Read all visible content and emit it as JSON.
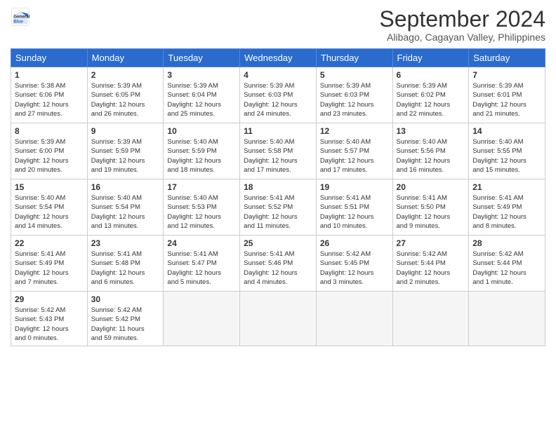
{
  "logo": {
    "line1": "General",
    "line2": "Blue"
  },
  "title": "September 2024",
  "location": "Alibago, Cagayan Valley, Philippines",
  "headers": [
    "Sunday",
    "Monday",
    "Tuesday",
    "Wednesday",
    "Thursday",
    "Friday",
    "Saturday"
  ],
  "weeks": [
    [
      {
        "day": "1",
        "info": "Sunrise: 5:38 AM\nSunset: 6:06 PM\nDaylight: 12 hours\nand 27 minutes."
      },
      {
        "day": "2",
        "info": "Sunrise: 5:39 AM\nSunset: 6:05 PM\nDaylight: 12 hours\nand 26 minutes."
      },
      {
        "day": "3",
        "info": "Sunrise: 5:39 AM\nSunset: 6:04 PM\nDaylight: 12 hours\nand 25 minutes."
      },
      {
        "day": "4",
        "info": "Sunrise: 5:39 AM\nSunset: 6:03 PM\nDaylight: 12 hours\nand 24 minutes."
      },
      {
        "day": "5",
        "info": "Sunrise: 5:39 AM\nSunset: 6:03 PM\nDaylight: 12 hours\nand 23 minutes."
      },
      {
        "day": "6",
        "info": "Sunrise: 5:39 AM\nSunset: 6:02 PM\nDaylight: 12 hours\nand 22 minutes."
      },
      {
        "day": "7",
        "info": "Sunrise: 5:39 AM\nSunset: 6:01 PM\nDaylight: 12 hours\nand 21 minutes."
      }
    ],
    [
      {
        "day": "8",
        "info": "Sunrise: 5:39 AM\nSunset: 6:00 PM\nDaylight: 12 hours\nand 20 minutes."
      },
      {
        "day": "9",
        "info": "Sunrise: 5:39 AM\nSunset: 5:59 PM\nDaylight: 12 hours\nand 19 minutes."
      },
      {
        "day": "10",
        "info": "Sunrise: 5:40 AM\nSunset: 5:59 PM\nDaylight: 12 hours\nand 18 minutes."
      },
      {
        "day": "11",
        "info": "Sunrise: 5:40 AM\nSunset: 5:58 PM\nDaylight: 12 hours\nand 17 minutes."
      },
      {
        "day": "12",
        "info": "Sunrise: 5:40 AM\nSunset: 5:57 PM\nDaylight: 12 hours\nand 17 minutes."
      },
      {
        "day": "13",
        "info": "Sunrise: 5:40 AM\nSunset: 5:56 PM\nDaylight: 12 hours\nand 16 minutes."
      },
      {
        "day": "14",
        "info": "Sunrise: 5:40 AM\nSunset: 5:55 PM\nDaylight: 12 hours\nand 15 minutes."
      }
    ],
    [
      {
        "day": "15",
        "info": "Sunrise: 5:40 AM\nSunset: 5:54 PM\nDaylight: 12 hours\nand 14 minutes."
      },
      {
        "day": "16",
        "info": "Sunrise: 5:40 AM\nSunset: 5:54 PM\nDaylight: 12 hours\nand 13 minutes."
      },
      {
        "day": "17",
        "info": "Sunrise: 5:40 AM\nSunset: 5:53 PM\nDaylight: 12 hours\nand 12 minutes."
      },
      {
        "day": "18",
        "info": "Sunrise: 5:41 AM\nSunset: 5:52 PM\nDaylight: 12 hours\nand 11 minutes."
      },
      {
        "day": "19",
        "info": "Sunrise: 5:41 AM\nSunset: 5:51 PM\nDaylight: 12 hours\nand 10 minutes."
      },
      {
        "day": "20",
        "info": "Sunrise: 5:41 AM\nSunset: 5:50 PM\nDaylight: 12 hours\nand 9 minutes."
      },
      {
        "day": "21",
        "info": "Sunrise: 5:41 AM\nSunset: 5:49 PM\nDaylight: 12 hours\nand 8 minutes."
      }
    ],
    [
      {
        "day": "22",
        "info": "Sunrise: 5:41 AM\nSunset: 5:49 PM\nDaylight: 12 hours\nand 7 minutes."
      },
      {
        "day": "23",
        "info": "Sunrise: 5:41 AM\nSunset: 5:48 PM\nDaylight: 12 hours\nand 6 minutes."
      },
      {
        "day": "24",
        "info": "Sunrise: 5:41 AM\nSunset: 5:47 PM\nDaylight: 12 hours\nand 5 minutes."
      },
      {
        "day": "25",
        "info": "Sunrise: 5:41 AM\nSunset: 5:46 PM\nDaylight: 12 hours\nand 4 minutes."
      },
      {
        "day": "26",
        "info": "Sunrise: 5:42 AM\nSunset: 5:45 PM\nDaylight: 12 hours\nand 3 minutes."
      },
      {
        "day": "27",
        "info": "Sunrise: 5:42 AM\nSunset: 5:44 PM\nDaylight: 12 hours\nand 2 minutes."
      },
      {
        "day": "28",
        "info": "Sunrise: 5:42 AM\nSunset: 5:44 PM\nDaylight: 12 hours\nand 1 minute."
      }
    ],
    [
      {
        "day": "29",
        "info": "Sunrise: 5:42 AM\nSunset: 5:43 PM\nDaylight: 12 hours\nand 0 minutes."
      },
      {
        "day": "30",
        "info": "Sunrise: 5:42 AM\nSunset: 5:42 PM\nDaylight: 11 hours\nand 59 minutes."
      },
      {
        "day": "",
        "info": ""
      },
      {
        "day": "",
        "info": ""
      },
      {
        "day": "",
        "info": ""
      },
      {
        "day": "",
        "info": ""
      },
      {
        "day": "",
        "info": ""
      }
    ]
  ]
}
